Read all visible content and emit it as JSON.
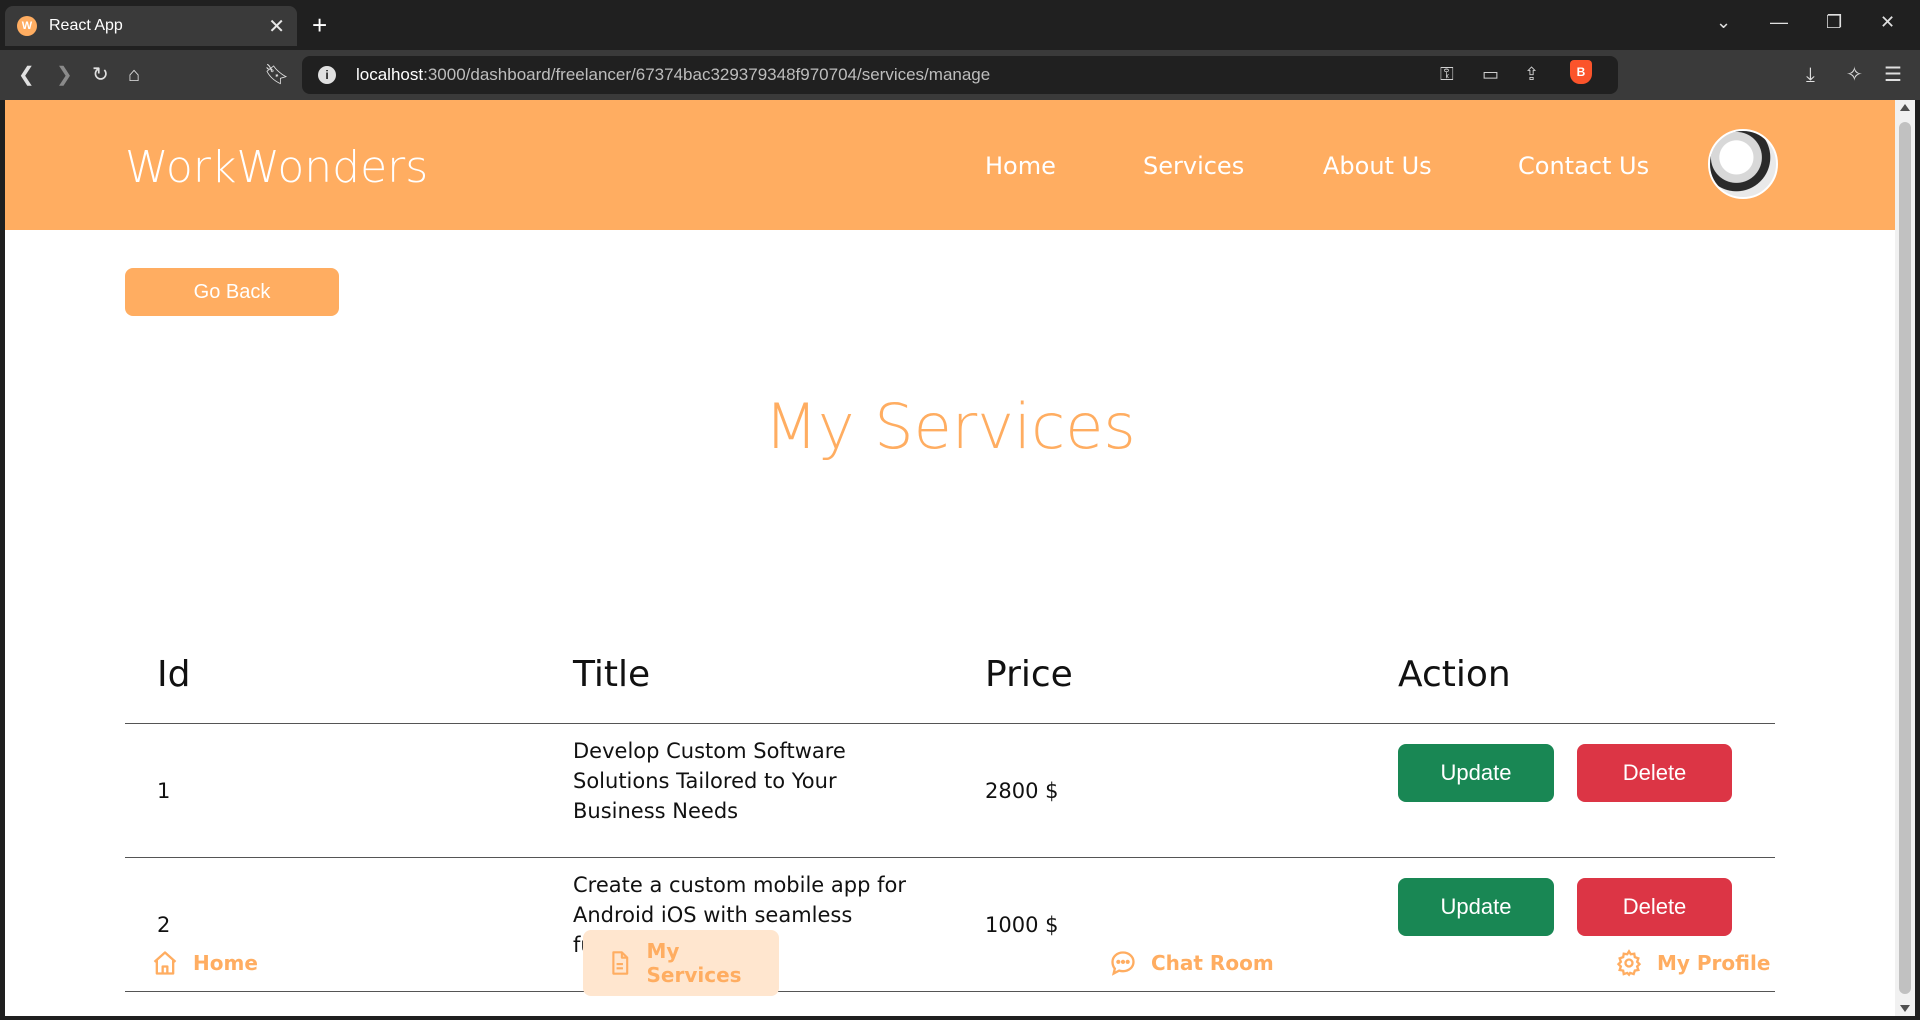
{
  "browser": {
    "tab_title": "React App",
    "tab_favicon_letter": "W",
    "url_host": "localhost",
    "url_path": ":3000/dashboard/freelancer/67374bac329379348f970704/services/manage"
  },
  "navbar": {
    "brand": "WorkWonders",
    "links": [
      "Home",
      "Services",
      "About Us",
      "Contact Us"
    ]
  },
  "go_back_label": "Go Back",
  "page_title": "My Services",
  "table": {
    "headers": [
      "Id",
      "Title",
      "Price",
      "Action"
    ],
    "rows": [
      {
        "id": "1",
        "title": "Develop Custom Software Solutions Tailored to Your Business Needs",
        "price": "2800 $"
      },
      {
        "id": "2",
        "title": "Create a custom mobile app for Android iOS with seamless functionality",
        "price": "1000 $"
      }
    ],
    "update_label": "Update",
    "delete_label": "Delete"
  },
  "bottom_nav": {
    "items": [
      "Home",
      "My Services",
      "Chat Room",
      "My Profile"
    ],
    "active": "My Services"
  },
  "colors": {
    "accent": "#ffad61",
    "update": "#198754",
    "delete": "#dc3545"
  }
}
